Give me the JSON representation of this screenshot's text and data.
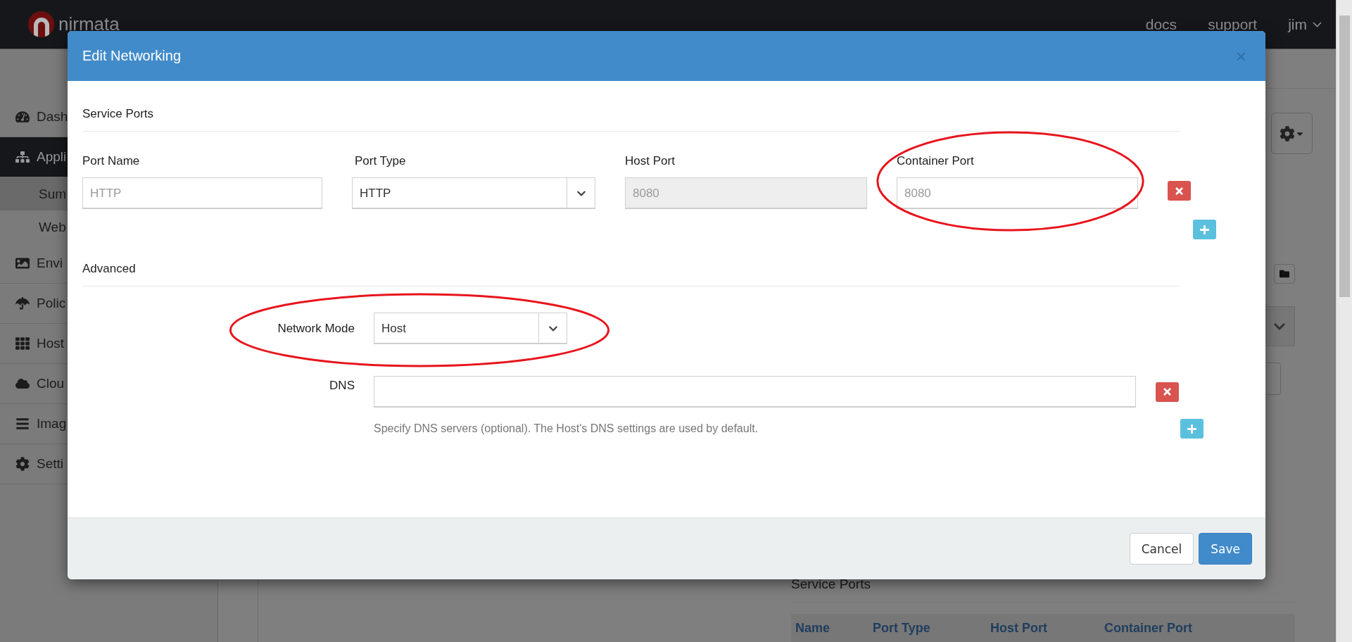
{
  "header": {
    "brand": "nirmata",
    "nav": [
      "docs",
      "support"
    ],
    "user": "jim"
  },
  "sidebar": {
    "items": [
      {
        "label": "Dash",
        "selected": false
      },
      {
        "label": "Appli",
        "selected": true,
        "children": [
          {
            "label": "Sum",
            "selected": true
          },
          {
            "label": "Web",
            "selected": false
          }
        ]
      },
      {
        "label": "Envi",
        "selected": false
      },
      {
        "label": "Polic",
        "selected": false
      },
      {
        "label": "Host",
        "selected": false
      },
      {
        "label": "Clou",
        "selected": false
      },
      {
        "label": "Imag",
        "selected": false
      },
      {
        "label": "Setti",
        "selected": false
      }
    ]
  },
  "background": {
    "section_title": "Service Ports",
    "table_columns": [
      "Name",
      "Port Type",
      "Host Port",
      "Container Port"
    ]
  },
  "modal": {
    "title": "Edit Networking",
    "close": "×",
    "service_ports": {
      "title": "Service Ports",
      "columns": [
        {
          "label": "Port Name",
          "kind": "text",
          "placeholder": "HTTP",
          "disabled": false,
          "highlighted": false
        },
        {
          "label": "Port Type",
          "kind": "select",
          "value": "HTTP",
          "disabled": false,
          "highlighted": false
        },
        {
          "label": "Host Port",
          "kind": "text",
          "placeholder": "8080",
          "disabled": true,
          "highlighted": false
        },
        {
          "label": "Container Port",
          "kind": "text",
          "placeholder": "8080",
          "disabled": false,
          "highlighted": true
        }
      ]
    },
    "advanced": {
      "title": "Advanced",
      "network_mode": {
        "label": "Network Mode",
        "value": "Host",
        "highlighted": true
      },
      "dns": {
        "label": "DNS",
        "help": "Specify DNS servers (optional). The Host's DNS settings are used by default."
      }
    },
    "buttons": [
      {
        "label": "Cancel",
        "kind": "default"
      },
      {
        "label": "Save",
        "kind": "primary"
      }
    ]
  }
}
